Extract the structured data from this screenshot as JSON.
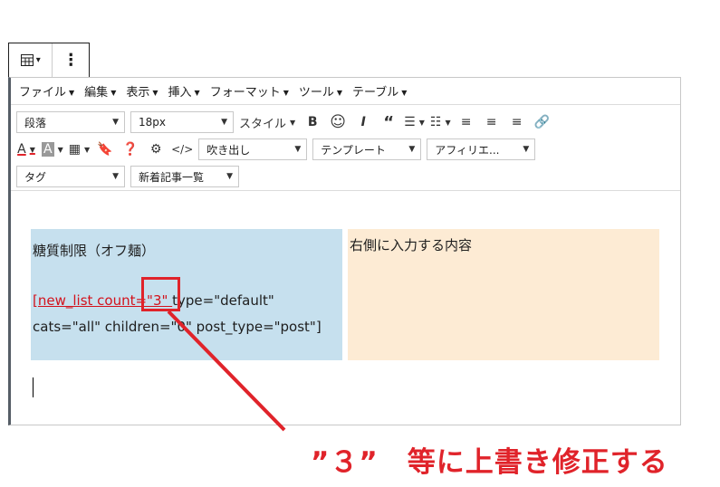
{
  "block_toolbar": {
    "table_icon": "table-icon",
    "more_icon": "vertical-ellipsis-icon"
  },
  "menubar": [
    {
      "label": "ファイル"
    },
    {
      "label": "編集"
    },
    {
      "label": "表示"
    },
    {
      "label": "挿入"
    },
    {
      "label": "フォーマット"
    },
    {
      "label": "ツール"
    },
    {
      "label": "テーブル"
    }
  ],
  "toolbar": {
    "paragraph_select": "段落",
    "font_size_select": "18px",
    "style_button": "スタイル",
    "speech_bubble_select": "吹き出し",
    "template_select": "テンプレート",
    "affiliate_select": "アフィリエ...",
    "tag_select": "タグ",
    "new_posts_select": "新着記事一覧"
  },
  "table": {
    "left_cell": {
      "line1": "糖質制限（オフ麺）",
      "shortcode_link": "[new_list count=\"3\" ",
      "shortcode_rest": "type=\"default\"",
      "line3": "cats=\"all\" children=\"0\" post_type=\"post\"]"
    },
    "right_cell": {
      "text": "右側に入力する内容"
    }
  },
  "annotation": {
    "text": "”３”　等に上書き修正する",
    "color": "#e0232a"
  }
}
